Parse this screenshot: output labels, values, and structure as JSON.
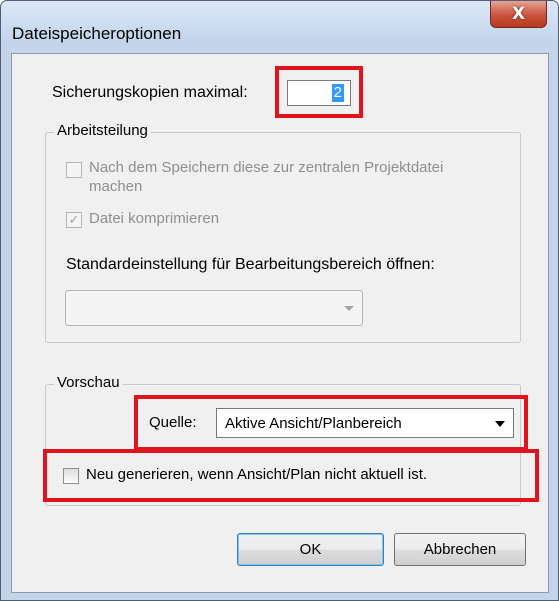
{
  "window": {
    "title": "Dateispeicheroptionen",
    "close_glyph": "X"
  },
  "backups": {
    "label": "Sicherungskopien maximal:",
    "value": "2"
  },
  "worksharing": {
    "group_title": "Arbeitsteilung",
    "make_central_label_line1": "Nach dem Speichern diese zur zentralen Projektdatei",
    "make_central_label_line2": "machen",
    "make_central_checked": false,
    "compress_label": "Datei komprimieren",
    "compress_checked": true,
    "default_workset_label": "Standardeinstellung für Bearbeitungsbereich öffnen:",
    "default_workset_value": ""
  },
  "preview": {
    "group_title": "Vorschau",
    "source_label": "Quelle:",
    "source_value": "Aktive Ansicht/Planbereich",
    "regenerate_label": "Neu generieren, wenn Ansicht/Plan nicht aktuell ist.",
    "regenerate_checked": false
  },
  "buttons": {
    "ok": "OK",
    "cancel": "Abbrechen"
  },
  "colors": {
    "highlight": "#e0141e",
    "selection": "#3399ff",
    "close_button": "#c9523c"
  },
  "icons": {
    "close": "close-icon",
    "check": "checkmark-icon",
    "dropdown": "chevron-down-icon"
  }
}
